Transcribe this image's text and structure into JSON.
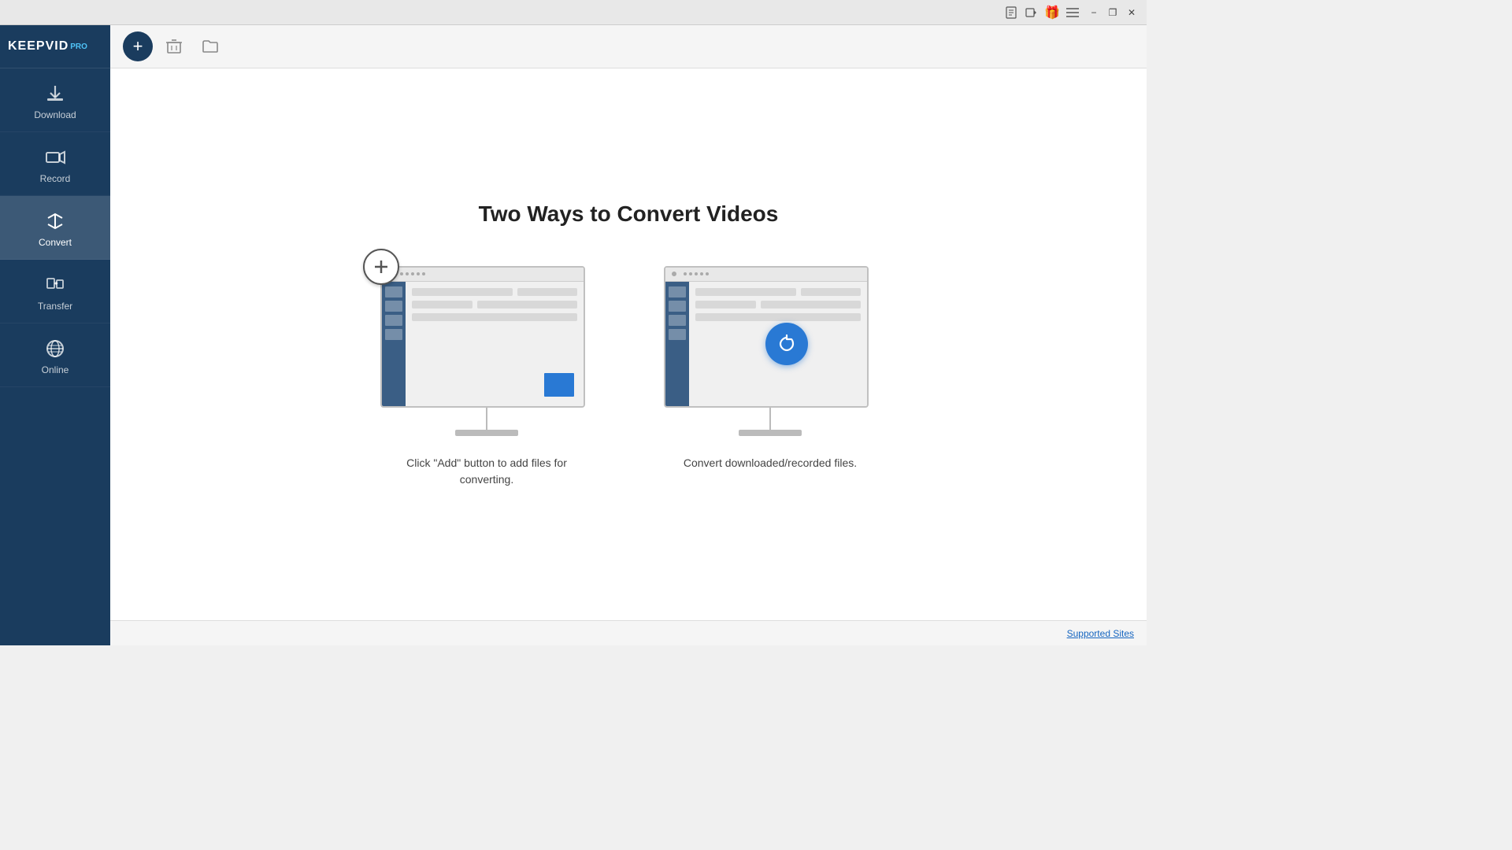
{
  "titlebar": {
    "icons": [
      "notepad-icon",
      "video-icon",
      "gift-icon",
      "menu-icon"
    ],
    "minimize_label": "−",
    "restore_label": "❐",
    "close_label": "✕"
  },
  "sidebar": {
    "logo": "KEEPVID",
    "logo_pro": "PRO",
    "items": [
      {
        "id": "download",
        "label": "Download",
        "icon": "download"
      },
      {
        "id": "record",
        "label": "Record",
        "icon": "record"
      },
      {
        "id": "convert",
        "label": "Convert",
        "icon": "convert",
        "active": true
      },
      {
        "id": "transfer",
        "label": "Transfer",
        "icon": "transfer"
      },
      {
        "id": "online",
        "label": "Online",
        "icon": "online"
      }
    ]
  },
  "toolbar": {
    "add_label": "+",
    "delete_label": "🗑",
    "folder_label": "📁"
  },
  "main": {
    "title": "Two Ways to Convert Videos",
    "card1": {
      "description": "Click \"Add\" button to add files for converting."
    },
    "card2": {
      "description": "Convert downloaded/recorded files."
    }
  },
  "footer": {
    "supported_sites": "Supported Sites"
  }
}
